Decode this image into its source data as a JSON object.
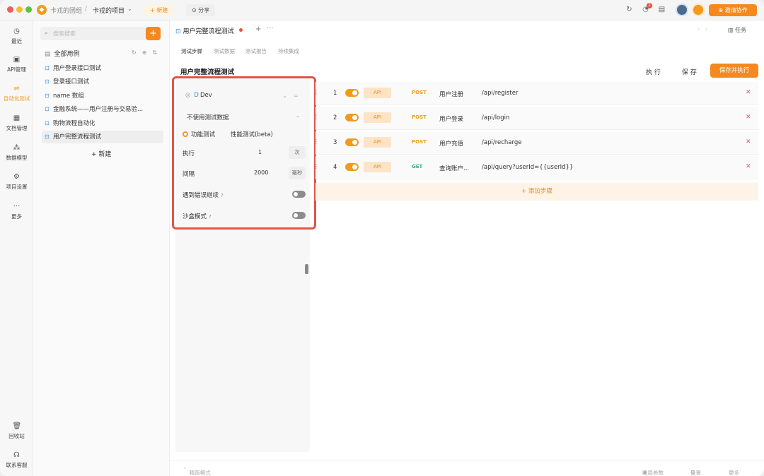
{
  "titlebar": {
    "team": "卡戎的团组",
    "separator": "/",
    "project": "卡戎的项目",
    "new_label": "新建",
    "share_label": "分享",
    "notification_count": "2",
    "invite_label": "邀请协作"
  },
  "nav": {
    "items": [
      {
        "label": "最近",
        "icon": "clock-icon"
      },
      {
        "label": "API管理",
        "icon": "api-icon"
      },
      {
        "label": "自动化测试",
        "icon": "automation-icon"
      },
      {
        "label": "文档管理",
        "icon": "document-icon"
      },
      {
        "label": "数据模型",
        "icon": "model-icon"
      },
      {
        "label": "项目设置",
        "icon": "settings-icon"
      },
      {
        "label": "更多",
        "icon": "more-icon"
      }
    ],
    "bottom": [
      {
        "label": "回收站",
        "icon": "trash-icon"
      },
      {
        "label": "联系客服",
        "icon": "headset-icon"
      }
    ]
  },
  "tree": {
    "search_placeholder": "搜索搜索",
    "root_label": "全部用例",
    "items": [
      "用户登录接口测试",
      "登录接口测试",
      "name 数组",
      "金融系统——用户注册与交易验...",
      "购物流程自动化",
      "用户完整流程测试"
    ],
    "new_label": "新建"
  },
  "tab": {
    "title": "用户完整流程测试",
    "task_label": "任务"
  },
  "subtabs": [
    "测试步骤",
    "测试数据",
    "测试报告",
    "持续集成"
  ],
  "case": {
    "title": "用户完整流程测试",
    "run_label": "执 行",
    "save_label": "保 存",
    "save_run_label": "保存并执行"
  },
  "config": {
    "env": "Dev",
    "test_data": "不使用测试数据",
    "mode_functional": "功能测试",
    "mode_performance": "性能测试(beta)",
    "run_label": "执行",
    "run_value": "1",
    "run_unit": "次",
    "interval_label": "间隔",
    "interval_value": "2000",
    "interval_unit": "毫秒",
    "continue_on_error": "遇到错误继续",
    "sandbox": "沙盒模式"
  },
  "steps": [
    {
      "num": "1",
      "tag": "API",
      "method": "POST",
      "name": "用户注册",
      "path": "/api/register"
    },
    {
      "num": "2",
      "tag": "API",
      "method": "POST",
      "name": "用户登录",
      "path": "/api/login"
    },
    {
      "num": "3",
      "tag": "API",
      "method": "POST",
      "name": "用户充值",
      "path": "/api/recharge"
    },
    {
      "num": "4",
      "tag": "API",
      "method": "GET",
      "name": "查询账户...",
      "path": "/api/query?userId={{userId}}"
    }
  ],
  "add_step_label": "+ 添加步骤",
  "footer": {
    "left": "精简模式",
    "global_params": "全局参数",
    "settings": "设置",
    "more": "更多"
  },
  "colors": {
    "accent": "#f5891d",
    "post": "#e8a21a",
    "get": "#2fb37a",
    "highlight_box": "#e0554a"
  }
}
